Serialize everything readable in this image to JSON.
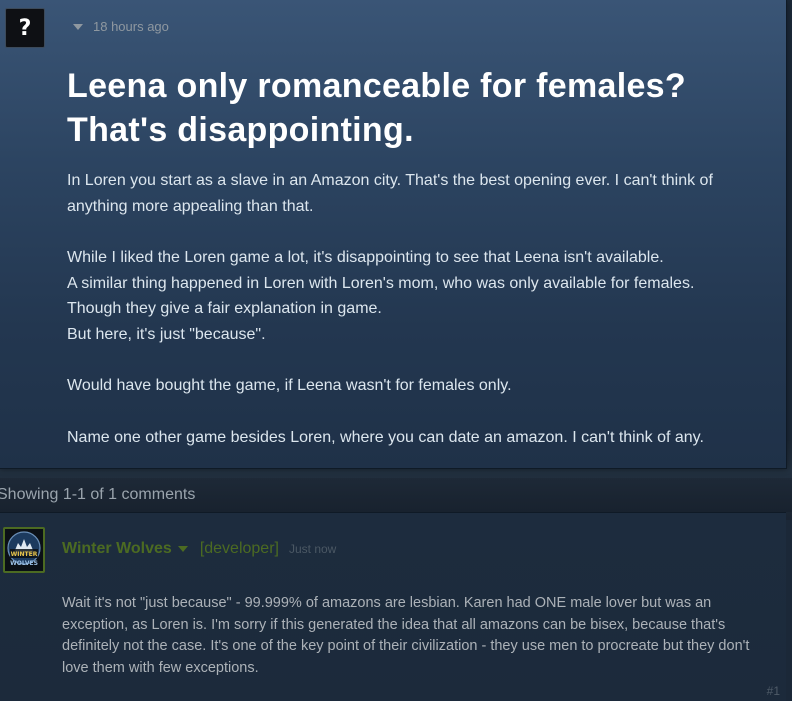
{
  "topic": {
    "avatar_glyph": "?",
    "timestamp": "18 hours ago",
    "title": "Leena only romanceable for females? That's disappointing.",
    "paragraphs": [
      "In Loren you start as a slave in an Amazon city. That's the best opening ever. I can't think of anything more appealing than that.",
      "While I liked the Loren game a lot, it's disappointing to see that Leena isn't available.",
      "A similar thing happened in Loren with Loren's mom, who was only available for females.",
      "Though they give a fair explanation in game.",
      "But here, it's just \"because\".",
      "Would have bought the game, if Leena wasn't for females only.",
      "Name one other game besides Loren, where you can date an amazon. I can't think of any."
    ]
  },
  "comments_header": {
    "showing_text": "Showing 1-1 of 1 comments"
  },
  "comment": {
    "avatar_text": "WINTER WOLVES",
    "author": "Winter Wolves",
    "role": "[developer]",
    "timestamp": "Just now",
    "text": "Wait it's not \"just because\" - 99.999% of amazons are lesbian. Karen had ONE male lover but was an exception, as Loren is. I'm sorry if this generated the idea that all amazons can be bisex, because that's definitely not the case. It's one of the key point of their civilization - they use men to procreate but they don't love them with few exceptions.",
    "number": "#1"
  },
  "colors": {
    "background": "#1b2838",
    "title": "#ffffff",
    "developer_green": "#4c6b22",
    "comment_text": "#acb2b8"
  }
}
